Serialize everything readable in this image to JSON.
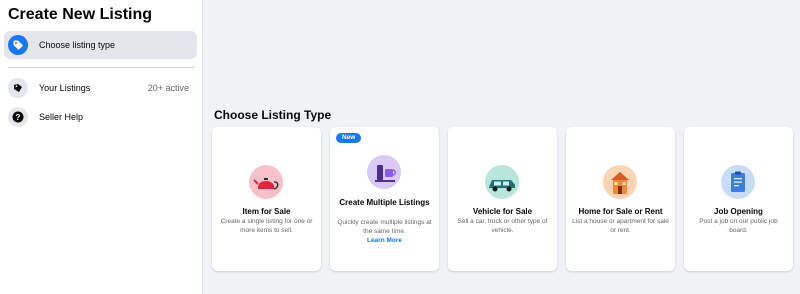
{
  "sidebar": {
    "title": "Create New Listing",
    "items": [
      {
        "label": "Choose listing type",
        "icon": "tag-icon",
        "active": true
      },
      {
        "label": "Your Listings",
        "icon": "listings-icon",
        "meta": "20+ active"
      },
      {
        "label": "Seller Help",
        "icon": "question-icon"
      }
    ]
  },
  "main": {
    "section_title": "Choose Listing Type",
    "cards": [
      {
        "title": "Item for Sale",
        "description": "Create a single listing for one or more items to sell.",
        "icon": "teapot-icon"
      },
      {
        "title": "Create Multiple Listings",
        "description": "Quickly create multiple listings at the same time.",
        "link": "Learn More",
        "badge": "New",
        "icon": "cups-icon"
      },
      {
        "title": "Vehicle for Sale",
        "description": "Sell a car, truck or other type of vehicle.",
        "icon": "car-icon"
      },
      {
        "title": "Home for Sale or Rent",
        "description": "List a house or apartment for sale or rent.",
        "icon": "house-icon"
      },
      {
        "title": "Job Opening",
        "description": "Post a job on our public job board.",
        "icon": "clipboard-icon"
      }
    ]
  },
  "colors": {
    "accent": "#1877f2",
    "page_bg": "#f0f2f5",
    "secondary_text": "#65676b"
  }
}
